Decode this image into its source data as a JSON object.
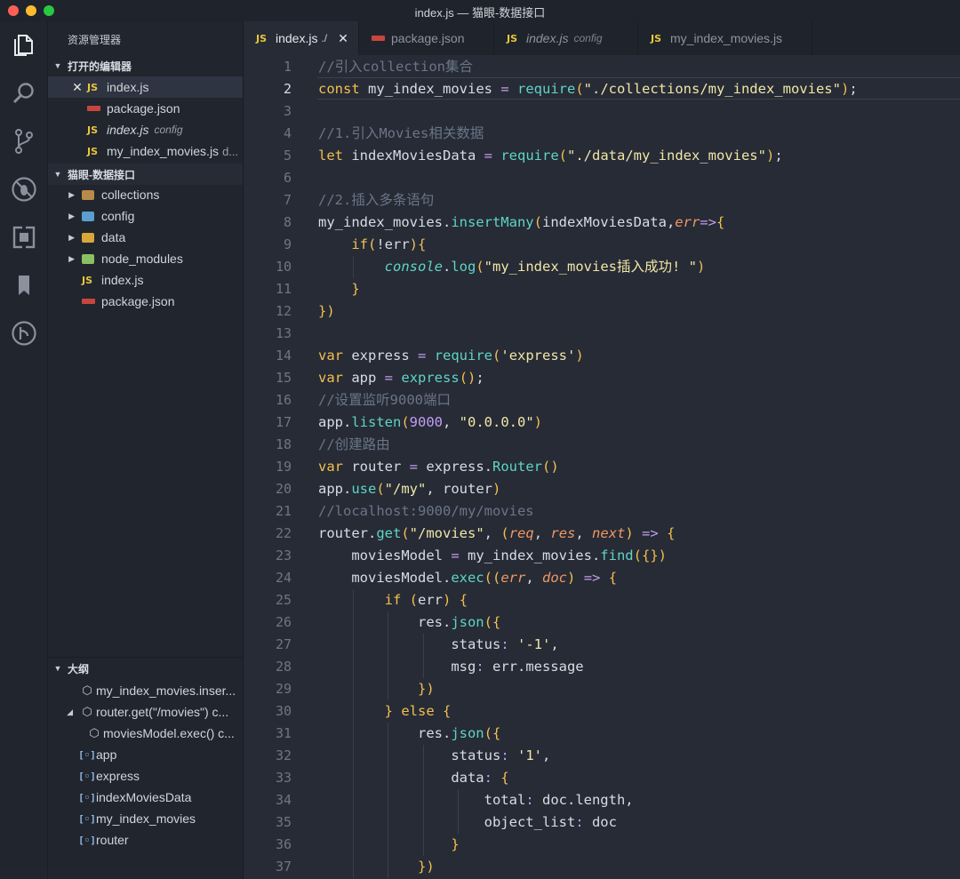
{
  "window": {
    "title": "index.js — 猫眼-数据接口"
  },
  "sidebar": {
    "title": "资源管理器",
    "open_editors_header": "打开的编辑器",
    "open_editors": [
      {
        "name": "index.js",
        "desc": ""
      },
      {
        "name": "package.json",
        "desc": ""
      },
      {
        "name": "index.js",
        "desc": "config"
      },
      {
        "name": "my_index_movies.js",
        "desc": "d..."
      }
    ],
    "project_header": "猫眼-数据接口",
    "tree": [
      {
        "name": "collections"
      },
      {
        "name": "config"
      },
      {
        "name": "data"
      },
      {
        "name": "node_modules"
      },
      {
        "name": "index.js"
      },
      {
        "name": "package.json"
      }
    ],
    "outline_header": "大纲",
    "outline": [
      {
        "name": "my_index_movies.inser..."
      },
      {
        "name": "router.get(\"/movies\") c..."
      },
      {
        "name": "moviesModel.exec() c..."
      },
      {
        "name": "app"
      },
      {
        "name": "express"
      },
      {
        "name": "indexMoviesData"
      },
      {
        "name": "my_index_movies"
      },
      {
        "name": "router"
      }
    ]
  },
  "tabs": [
    {
      "label": "index.js",
      "desc": "./"
    },
    {
      "label": "package.json"
    },
    {
      "label": "index.js",
      "desc": "config"
    },
    {
      "label": "my_index_movies.js"
    }
  ],
  "editor": {
    "line_numbers": [
      "1",
      "2",
      "3",
      "4",
      "5",
      "6",
      "7",
      "8",
      "9",
      "10",
      "11",
      "12",
      "13",
      "14",
      "15",
      "16",
      "17",
      "18",
      "19",
      "20",
      "21",
      "22",
      "23",
      "24",
      "25",
      "26",
      "27",
      "28",
      "29",
      "30",
      "31",
      "32",
      "33",
      "34",
      "35",
      "36",
      "37"
    ],
    "lines": [
      "//引入collection集合",
      "const my_index_movies = require(\"./collections/my_index_movies\");",
      "",
      "//1.引入Movies相关数据",
      "let indexMoviesData = require(\"./data/my_index_movies\");",
      "",
      "//2.插入多条语句",
      "my_index_movies.insertMany(indexMoviesData,err=>{",
      "    if(!err){",
      "        console.log(\"my_index_movies插入成功! \")",
      "    }",
      "})",
      "",
      "var express = require('express')",
      "var app = express();",
      "//设置监听9000端口",
      "app.listen(9000, \"0.0.0.0\")",
      "//创建路由",
      "var router = express.Router()",
      "app.use(\"/my\", router)",
      "//localhost:9000/my/movies",
      "router.get(\"/movies\", (req, res, next) => {",
      "    moviesModel = my_index_movies.find({})",
      "    moviesModel.exec((err, doc) => {",
      "        if (err) {",
      "            res.json({",
      "                status: '-1',",
      "                msg: err.message",
      "            })",
      "        } else {",
      "            res.json({",
      "                status: '1',",
      "                data: {",
      "                    total: doc.length,",
      "                    object_list: doc",
      "                }",
      "            })"
    ]
  },
  "colors": {
    "accent_js": "#e8c73b",
    "json_red": "#c8453e",
    "keyword": "#f4bf4f",
    "string": "#f1e6a6",
    "function": "#5fd4c6",
    "comment": "#6b7587"
  }
}
